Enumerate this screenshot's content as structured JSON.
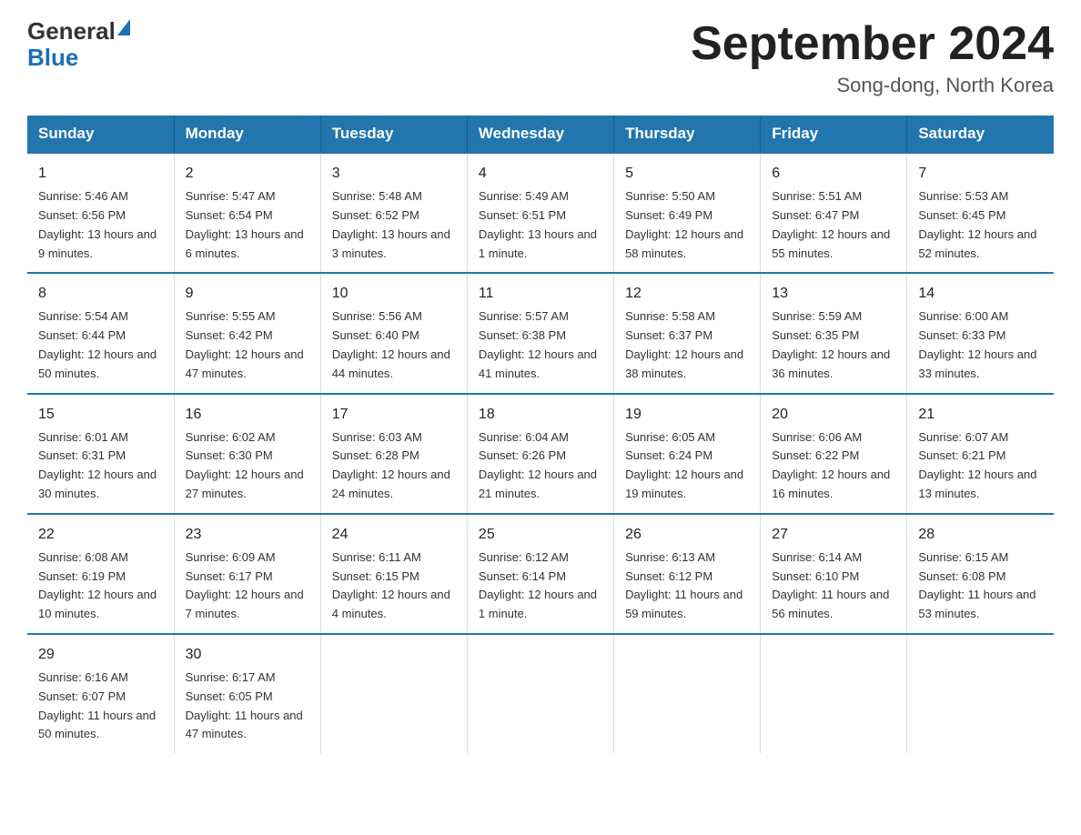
{
  "header": {
    "logo_general": "General",
    "logo_blue": "Blue",
    "title": "September 2024",
    "subtitle": "Song-dong, North Korea"
  },
  "days_of_week": [
    "Sunday",
    "Monday",
    "Tuesday",
    "Wednesday",
    "Thursday",
    "Friday",
    "Saturday"
  ],
  "weeks": [
    [
      {
        "day": "1",
        "sunrise": "5:46 AM",
        "sunset": "6:56 PM",
        "daylight": "13 hours and 9 minutes."
      },
      {
        "day": "2",
        "sunrise": "5:47 AM",
        "sunset": "6:54 PM",
        "daylight": "13 hours and 6 minutes."
      },
      {
        "day": "3",
        "sunrise": "5:48 AM",
        "sunset": "6:52 PM",
        "daylight": "13 hours and 3 minutes."
      },
      {
        "day": "4",
        "sunrise": "5:49 AM",
        "sunset": "6:51 PM",
        "daylight": "13 hours and 1 minute."
      },
      {
        "day": "5",
        "sunrise": "5:50 AM",
        "sunset": "6:49 PM",
        "daylight": "12 hours and 58 minutes."
      },
      {
        "day": "6",
        "sunrise": "5:51 AM",
        "sunset": "6:47 PM",
        "daylight": "12 hours and 55 minutes."
      },
      {
        "day": "7",
        "sunrise": "5:53 AM",
        "sunset": "6:45 PM",
        "daylight": "12 hours and 52 minutes."
      }
    ],
    [
      {
        "day": "8",
        "sunrise": "5:54 AM",
        "sunset": "6:44 PM",
        "daylight": "12 hours and 50 minutes."
      },
      {
        "day": "9",
        "sunrise": "5:55 AM",
        "sunset": "6:42 PM",
        "daylight": "12 hours and 47 minutes."
      },
      {
        "day": "10",
        "sunrise": "5:56 AM",
        "sunset": "6:40 PM",
        "daylight": "12 hours and 44 minutes."
      },
      {
        "day": "11",
        "sunrise": "5:57 AM",
        "sunset": "6:38 PM",
        "daylight": "12 hours and 41 minutes."
      },
      {
        "day": "12",
        "sunrise": "5:58 AM",
        "sunset": "6:37 PM",
        "daylight": "12 hours and 38 minutes."
      },
      {
        "day": "13",
        "sunrise": "5:59 AM",
        "sunset": "6:35 PM",
        "daylight": "12 hours and 36 minutes."
      },
      {
        "day": "14",
        "sunrise": "6:00 AM",
        "sunset": "6:33 PM",
        "daylight": "12 hours and 33 minutes."
      }
    ],
    [
      {
        "day": "15",
        "sunrise": "6:01 AM",
        "sunset": "6:31 PM",
        "daylight": "12 hours and 30 minutes."
      },
      {
        "day": "16",
        "sunrise": "6:02 AM",
        "sunset": "6:30 PM",
        "daylight": "12 hours and 27 minutes."
      },
      {
        "day": "17",
        "sunrise": "6:03 AM",
        "sunset": "6:28 PM",
        "daylight": "12 hours and 24 minutes."
      },
      {
        "day": "18",
        "sunrise": "6:04 AM",
        "sunset": "6:26 PM",
        "daylight": "12 hours and 21 minutes."
      },
      {
        "day": "19",
        "sunrise": "6:05 AM",
        "sunset": "6:24 PM",
        "daylight": "12 hours and 19 minutes."
      },
      {
        "day": "20",
        "sunrise": "6:06 AM",
        "sunset": "6:22 PM",
        "daylight": "12 hours and 16 minutes."
      },
      {
        "day": "21",
        "sunrise": "6:07 AM",
        "sunset": "6:21 PM",
        "daylight": "12 hours and 13 minutes."
      }
    ],
    [
      {
        "day": "22",
        "sunrise": "6:08 AM",
        "sunset": "6:19 PM",
        "daylight": "12 hours and 10 minutes."
      },
      {
        "day": "23",
        "sunrise": "6:09 AM",
        "sunset": "6:17 PM",
        "daylight": "12 hours and 7 minutes."
      },
      {
        "day": "24",
        "sunrise": "6:11 AM",
        "sunset": "6:15 PM",
        "daylight": "12 hours and 4 minutes."
      },
      {
        "day": "25",
        "sunrise": "6:12 AM",
        "sunset": "6:14 PM",
        "daylight": "12 hours and 1 minute."
      },
      {
        "day": "26",
        "sunrise": "6:13 AM",
        "sunset": "6:12 PM",
        "daylight": "11 hours and 59 minutes."
      },
      {
        "day": "27",
        "sunrise": "6:14 AM",
        "sunset": "6:10 PM",
        "daylight": "11 hours and 56 minutes."
      },
      {
        "day": "28",
        "sunrise": "6:15 AM",
        "sunset": "6:08 PM",
        "daylight": "11 hours and 53 minutes."
      }
    ],
    [
      {
        "day": "29",
        "sunrise": "6:16 AM",
        "sunset": "6:07 PM",
        "daylight": "11 hours and 50 minutes."
      },
      {
        "day": "30",
        "sunrise": "6:17 AM",
        "sunset": "6:05 PM",
        "daylight": "11 hours and 47 minutes."
      },
      null,
      null,
      null,
      null,
      null
    ]
  ]
}
